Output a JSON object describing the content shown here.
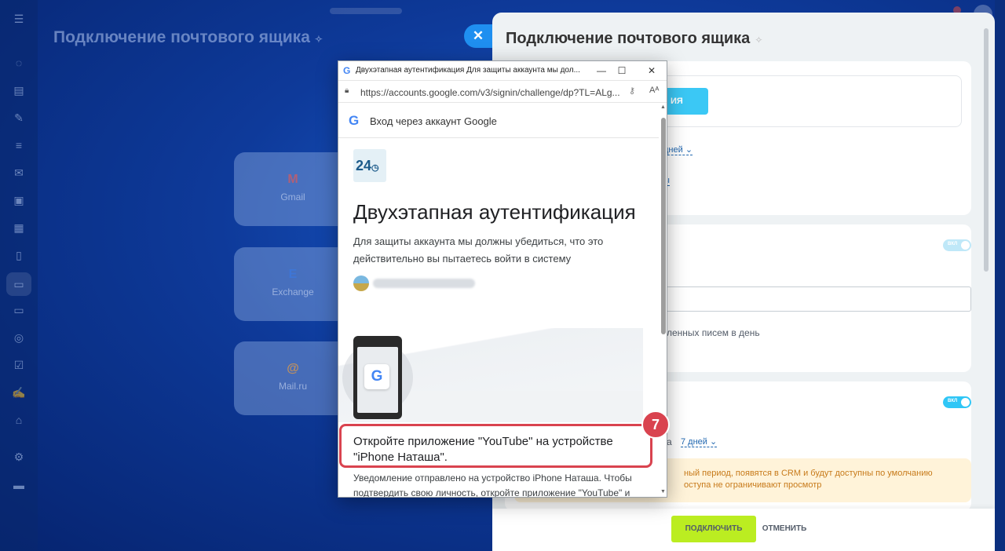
{
  "background": {
    "title": "Подключение почтового ящика",
    "cards": [
      {
        "logo": "M",
        "name": "Gmail"
      },
      {
        "logo": "E",
        "name": "Exchange"
      },
      {
        "logo": "@",
        "name": "Mail.ru"
      }
    ]
  },
  "panel": {
    "title": "Подключение почтового ящика",
    "button_partial": "ИЯ",
    "period_link_partial": "дней",
    "link2_partial": "ы",
    "toggle1": "ВКЛ",
    "toggle2": "ВКЛ",
    "limit_text_partial": "ленных писем в день",
    "period_label_partial": "а",
    "period_link": "7 дней",
    "warning_line1": "ный период, появятся в CRM и будут доступны по умолчанию",
    "warning_line2": "оступа не ограничивают просмотр",
    "connect_button": "ПОДКЛЮЧИТЬ",
    "cancel_button": "ОТМЕНИТЬ"
  },
  "popup": {
    "window_title": "Двухэтапная аутентификация Для защиты аккаунта мы дол...",
    "url": "https://accounts.google.com/v3/signin/challenge/dp?TL=ALg...",
    "google_header": "Вход через аккаунт Google",
    "app_logo": "24",
    "heading": "Двухэтапная аутентификация",
    "description": "Для защиты аккаунта мы должны убедиться, что это действительно вы пытаетесь войти в систему",
    "instruction": "Откройте приложение \"YouTube\" на устройстве \"iPhone Наташа\".",
    "notice": "Уведомление отправлено на устройство iPhone Наташа. Чтобы подтвердить свою личность, откройте приложение \"YouTube\" и"
  },
  "annotation": {
    "step": "7"
  },
  "colors": {
    "accent_blue": "#2fc6f6",
    "connect_green": "#bbed21",
    "annotation_red": "#d9434f",
    "background_blue": "#0e3a9a"
  }
}
